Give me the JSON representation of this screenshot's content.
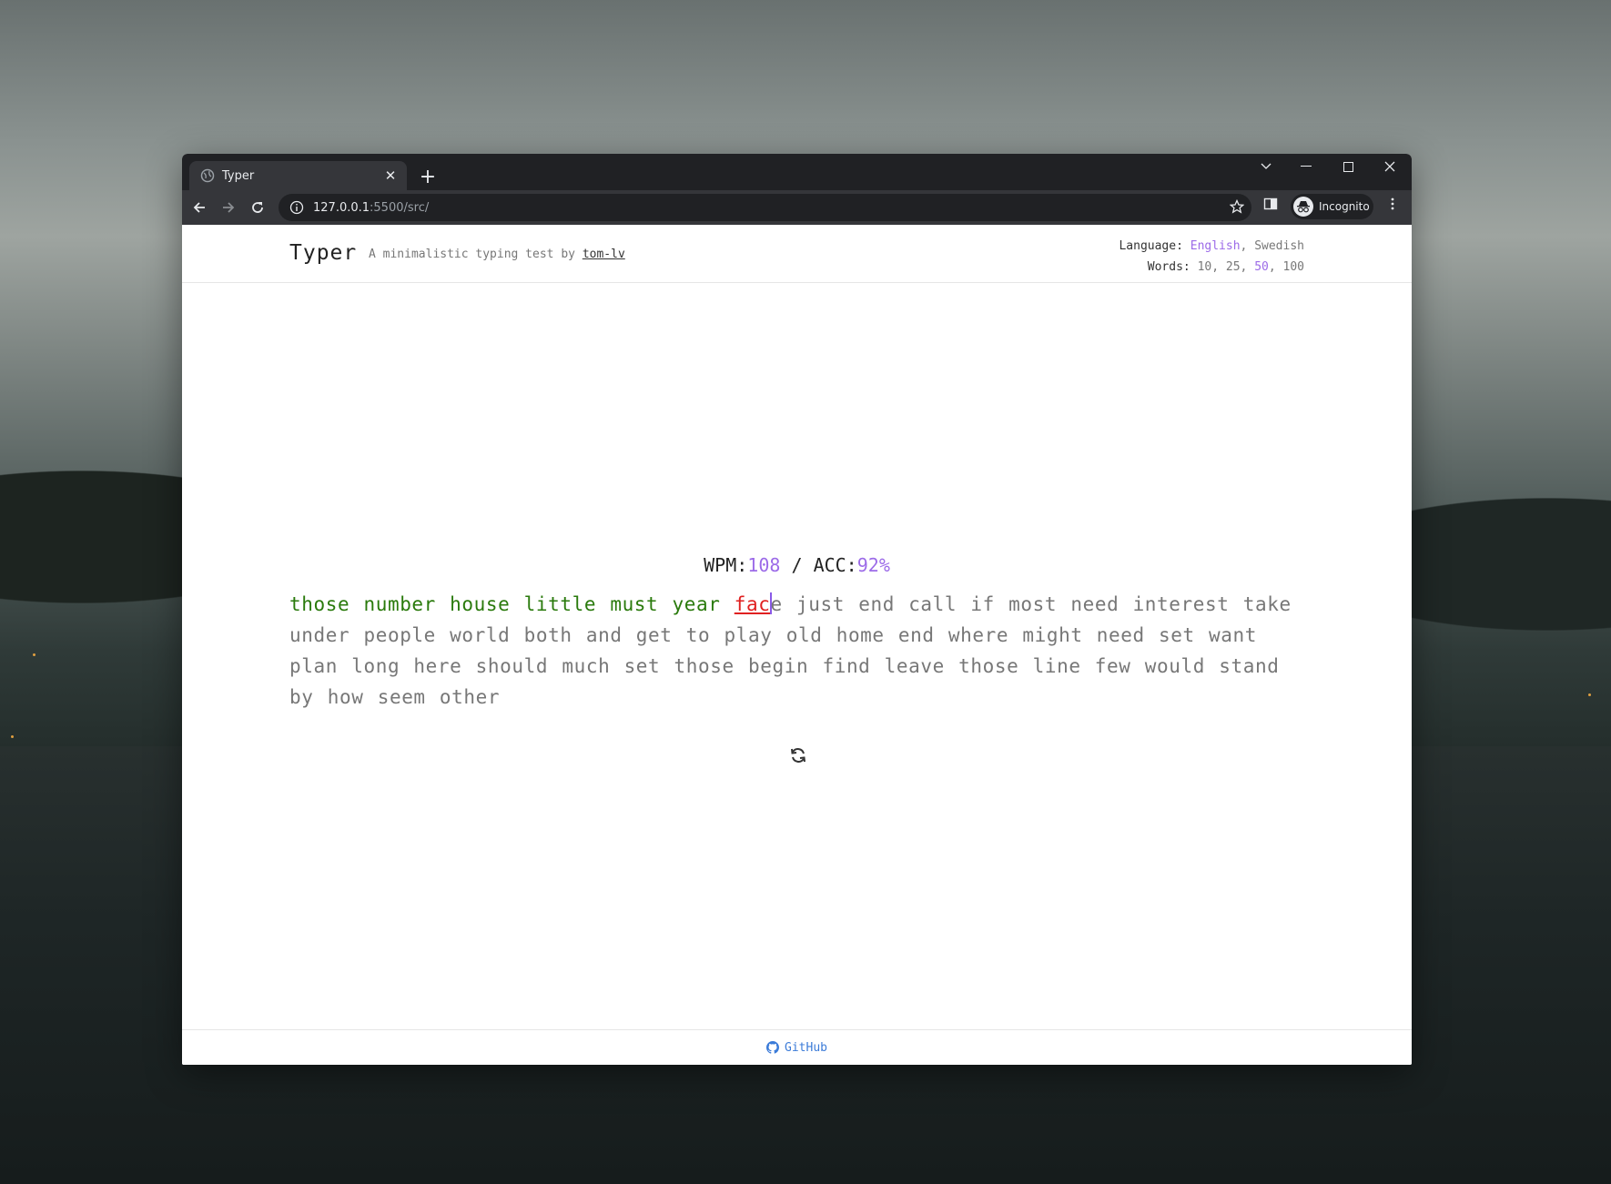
{
  "browser": {
    "tab_title": "Typer",
    "url_host": "127.0.0.1",
    "url_path": ":5500/src/",
    "profile_label": "Incognito"
  },
  "app": {
    "title": "Typer",
    "tagline_prefix": "A minimalistic typing test by",
    "author": "tom-lv"
  },
  "settings": {
    "language_label": "Language:",
    "languages": [
      "English",
      "Swedish"
    ],
    "active_language": "English",
    "words_label": "Words:",
    "word_counts": [
      "10",
      "25",
      "50",
      "100"
    ],
    "active_word_count": "50"
  },
  "stats": {
    "wpm_label": "WPM:",
    "wpm": "108",
    "separator": "/",
    "acc_label": "ACC:",
    "acc": "92%"
  },
  "typing": {
    "completed": "those number house little must year",
    "error_part": "fac",
    "current_rest": "e",
    "remaining": "just end call if most need interest take under people world both and get to play old home end where might need set want plan long here should much set those begin find leave those line few would stand by how seem other"
  },
  "colors": {
    "accent": "#9c6be8",
    "correct": "#2a7a0c",
    "error": "#e02020",
    "link": "#3b7bd8"
  },
  "footer": {
    "link_label": "GitHub"
  }
}
